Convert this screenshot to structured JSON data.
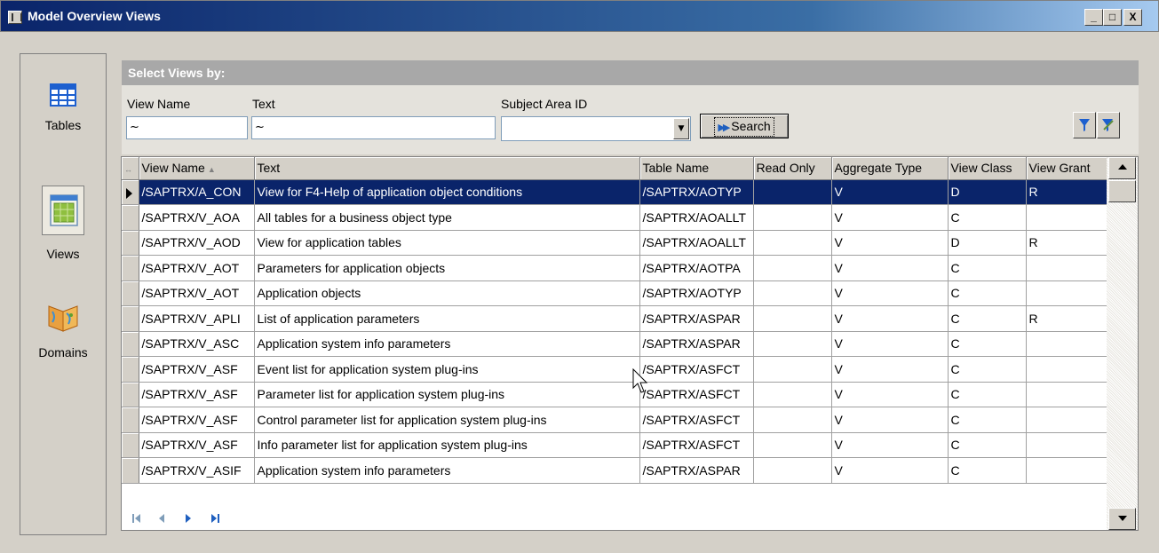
{
  "window": {
    "title": "Model Overview Views",
    "controls": [
      "_",
      "□",
      "X"
    ]
  },
  "nav": {
    "items": [
      {
        "label": "Tables",
        "icon": "table-grid-icon",
        "selected": false
      },
      {
        "label": "Views",
        "icon": "view-grid-icon",
        "selected": true
      },
      {
        "label": "Domains",
        "icon": "map-book-icon",
        "selected": false
      }
    ]
  },
  "filter": {
    "header": "Select Views by:",
    "view_name_label": "View Name",
    "view_name_value": "~",
    "text_label": "Text",
    "text_value": "~",
    "subject_area_label": "Subject Area ID",
    "subject_area_value": "",
    "search_label": "Search"
  },
  "grid": {
    "columns": [
      "View Name",
      "Text",
      "Table Name",
      "Read Only",
      "Aggregate Type",
      "View Class",
      "View Grant"
    ],
    "sorted_column": "View Name",
    "selected_row": 0,
    "rows": [
      [
        "/SAPTRX/A_CON",
        "View for F4-Help of application object conditions",
        "/SAPTRX/AOTYP",
        "",
        "V",
        "D",
        "R"
      ],
      [
        "/SAPTRX/V_AOA",
        "All tables for a business object type",
        "/SAPTRX/AOALLT",
        "",
        "V",
        "C",
        ""
      ],
      [
        "/SAPTRX/V_AOD",
        "View for application tables",
        "/SAPTRX/AOALLT",
        "",
        "V",
        "D",
        "R"
      ],
      [
        "/SAPTRX/V_AOT",
        "Parameters for application objects",
        "/SAPTRX/AOTPA",
        "",
        "V",
        "C",
        ""
      ],
      [
        "/SAPTRX/V_AOT",
        "Application objects",
        "/SAPTRX/AOTYP",
        "",
        "V",
        "C",
        ""
      ],
      [
        "/SAPTRX/V_APLI",
        "List of application parameters",
        "/SAPTRX/ASPAR",
        "",
        "V",
        "C",
        "R"
      ],
      [
        "/SAPTRX/V_ASC",
        "Application system info parameters",
        "/SAPTRX/ASPAR",
        "",
        "V",
        "C",
        ""
      ],
      [
        "/SAPTRX/V_ASF",
        "Event list for application system plug-ins",
        "/SAPTRX/ASFCT",
        "",
        "V",
        "C",
        ""
      ],
      [
        "/SAPTRX/V_ASF",
        "Parameter list for application system plug-ins",
        "/SAPTRX/ASFCT",
        "",
        "V",
        "C",
        ""
      ],
      [
        "/SAPTRX/V_ASF",
        "Control parameter list for application system plug-ins",
        "/SAPTRX/ASFCT",
        "",
        "V",
        "C",
        ""
      ],
      [
        "/SAPTRX/V_ASF",
        "Info parameter list for application system plug-ins",
        "/SAPTRX/ASFCT",
        "",
        "V",
        "C",
        ""
      ],
      [
        "/SAPTRX/V_ASIF",
        "Application system info parameters",
        "/SAPTRX/ASPAR",
        "",
        "V",
        "C",
        ""
      ]
    ]
  },
  "pager": [
    "first-page-icon",
    "previous-page-icon",
    "next-page-icon",
    "last-page-icon"
  ],
  "colors": {
    "selection": "#0a246a",
    "accent": "#1f5fbf"
  }
}
